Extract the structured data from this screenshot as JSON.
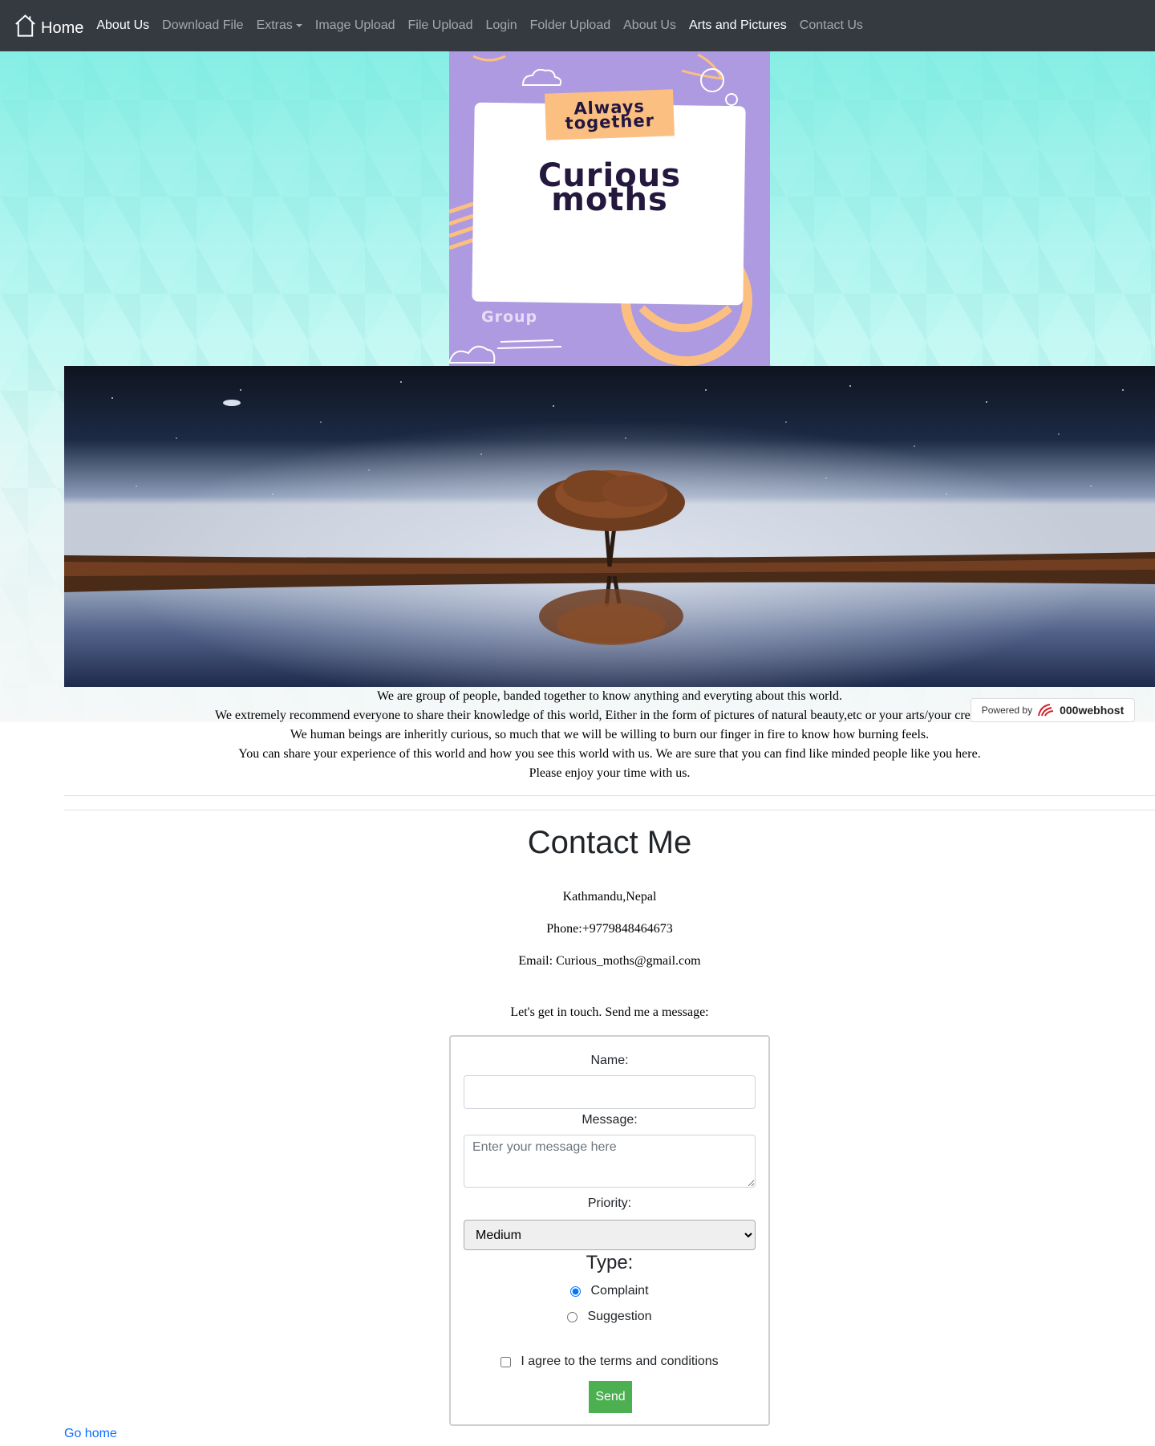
{
  "navbar": {
    "brand_label": "Home",
    "items": [
      {
        "label": "About Us"
      },
      {
        "label": "Download File"
      },
      {
        "label": "Extras"
      },
      {
        "label": "Image Upload"
      },
      {
        "label": "File Upload"
      },
      {
        "label": "Login"
      },
      {
        "label": "Folder Upload"
      },
      {
        "label": "About Us"
      },
      {
        "label": "Arts and Pictures"
      },
      {
        "label": "Contact Us"
      }
    ]
  },
  "poster": {
    "tag_line1": "Always",
    "tag_line2": "together",
    "title_line1": "Curious",
    "title_line2": "moths",
    "group": "Group"
  },
  "about": {
    "lines": [
      "We are group of people, banded together to know anything and everyting about this world.",
      "We extremely recommend everyone to share their knowledge of this world, Either in the form of pictures of natural beauty,etc or your arts/your creations.",
      "We human beings are inheritly curious, so much that we will be willing to burn our finger in fire to know how burning feels.",
      "You can share your experience of this world and how you see this world with us. We are sure that you can find like minded people like you here.",
      "Please enjoy your time with us."
    ]
  },
  "powered_by": {
    "prefix": "Powered by",
    "host": "000webhost"
  },
  "contact": {
    "title": "Contact Me",
    "location": "Kathmandu,Nepal",
    "phone": "Phone:+9779848464673",
    "email": "Email: Curious_moths@gmail.com",
    "invite": "Let's get in touch. Send me a message:"
  },
  "form": {
    "name_label": "Name:",
    "name_value": "",
    "message_label": "Message:",
    "message_placeholder": "Enter your message here",
    "priority_label": "Priority:",
    "priority_selected": "Medium",
    "type_title": "Type:",
    "type_options": [
      "Complaint",
      "Suggestion"
    ],
    "type_selected": "Complaint",
    "agree_label": "I agree to the terms and conditions",
    "agree_checked": false,
    "send_label": "Send"
  },
  "footer": {
    "go_home": "Go home"
  },
  "colors": {
    "navbar_bg": "#343a40",
    "send_button": "#4caf50",
    "link": "#0d6efd",
    "poster_bg": "#ad9ae0",
    "poster_accent": "#fcbf82"
  }
}
